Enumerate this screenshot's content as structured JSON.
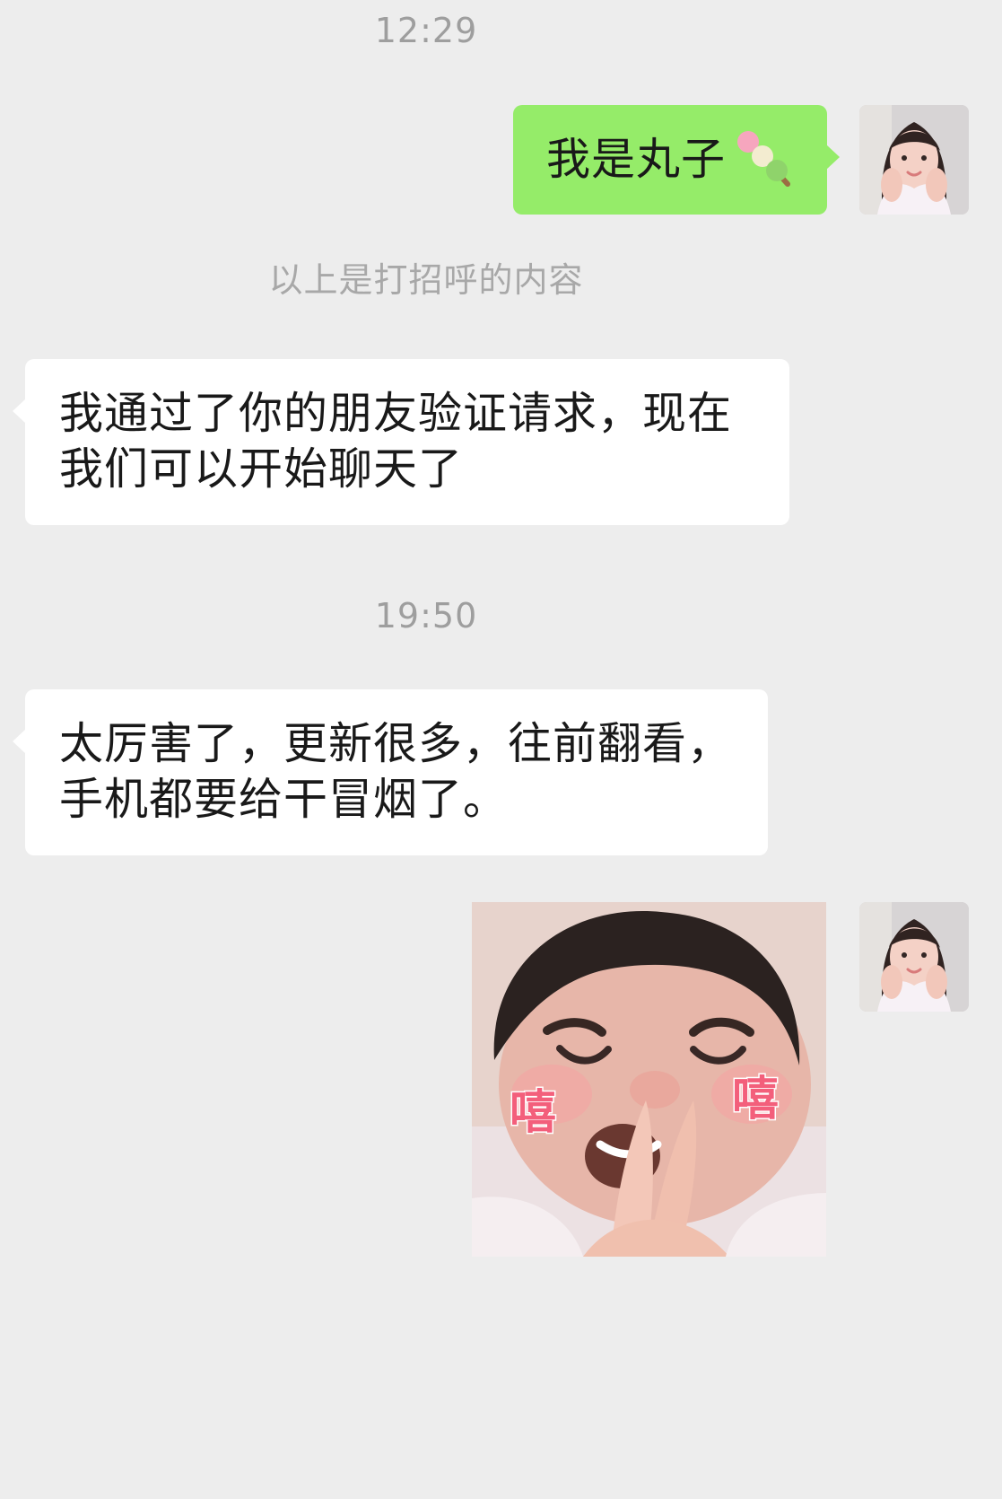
{
  "chat": {
    "timestamps": [
      "12:29",
      "19:50"
    ],
    "system_note": "以上是打招呼的内容",
    "messages": [
      {
        "side": "right",
        "type": "text",
        "text": "我是丸子",
        "emoji": "dango-emoji"
      },
      {
        "side": "left",
        "type": "text",
        "text": "我通过了你的朋友验证请求，现在我们可以开始聊天了"
      },
      {
        "side": "left",
        "type": "text",
        "text": "太厉害了，更新很多，往前翻看，手机都要给干冒烟了。"
      },
      {
        "side": "right",
        "type": "sticker",
        "sticker_text_left": "嘻",
        "sticker_text_right": "嘻"
      }
    ]
  },
  "colors": {
    "background": "#ededed",
    "sent_bubble": "#95ec69",
    "received_bubble": "#ffffff",
    "timestamp_text": "#9e9e9e",
    "message_text": "#191919",
    "sticker_text": "#f35f7b"
  },
  "icons": {
    "avatar": "user-avatar-photo",
    "emoji": "dango-emoji",
    "sticker": "laughing-baby-sticker"
  }
}
